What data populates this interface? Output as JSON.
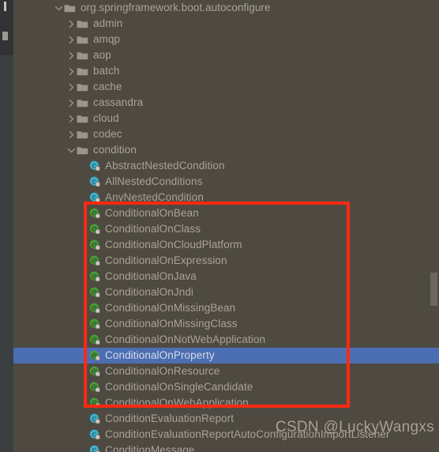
{
  "theme": {
    "background": "#4e4a41",
    "text": "#a9a398",
    "selection_background": "#4b6eb3",
    "selection_text": "#d6dbe3",
    "gutter": "#3c3f41",
    "annotation_box": "#fa2a12",
    "class_icon": "#3ab0c8",
    "annotation_icon": "#49a03b",
    "folder_icon": "#9b958b",
    "scrollbar_thumb": "#6c675d"
  },
  "tree": {
    "rows": [
      {
        "label": "org.springframework.boot.autoconfigure",
        "icon": "folder-icon",
        "expander": "chevron-down-icon",
        "depth": 0,
        "selected": false
      },
      {
        "label": "admin",
        "icon": "folder-icon",
        "expander": "chevron-right-icon",
        "depth": 1,
        "selected": false
      },
      {
        "label": "amqp",
        "icon": "folder-icon",
        "expander": "chevron-right-icon",
        "depth": 1,
        "selected": false
      },
      {
        "label": "aop",
        "icon": "folder-icon",
        "expander": "chevron-right-icon",
        "depth": 1,
        "selected": false
      },
      {
        "label": "batch",
        "icon": "folder-icon",
        "expander": "chevron-right-icon",
        "depth": 1,
        "selected": false
      },
      {
        "label": "cache",
        "icon": "folder-icon",
        "expander": "chevron-right-icon",
        "depth": 1,
        "selected": false
      },
      {
        "label": "cassandra",
        "icon": "folder-icon",
        "expander": "chevron-right-icon",
        "depth": 1,
        "selected": false
      },
      {
        "label": "cloud",
        "icon": "folder-icon",
        "expander": "chevron-right-icon",
        "depth": 1,
        "selected": false
      },
      {
        "label": "codec",
        "icon": "folder-icon",
        "expander": "chevron-right-icon",
        "depth": 1,
        "selected": false
      },
      {
        "label": "condition",
        "icon": "folder-icon",
        "expander": "chevron-down-icon",
        "depth": 1,
        "selected": false
      },
      {
        "label": "AbstractNestedCondition",
        "icon": "class-icon",
        "expander": "none",
        "depth": 2,
        "selected": false
      },
      {
        "label": "AllNestedConditions",
        "icon": "class-icon",
        "expander": "none",
        "depth": 2,
        "selected": false
      },
      {
        "label": "AnyNestedCondition",
        "icon": "class-icon",
        "expander": "none",
        "depth": 2,
        "selected": false
      },
      {
        "label": "ConditionalOnBean",
        "icon": "annotation-icon",
        "expander": "none",
        "depth": 2,
        "selected": false
      },
      {
        "label": "ConditionalOnClass",
        "icon": "annotation-icon",
        "expander": "none",
        "depth": 2,
        "selected": false
      },
      {
        "label": "ConditionalOnCloudPlatform",
        "icon": "annotation-icon",
        "expander": "none",
        "depth": 2,
        "selected": false
      },
      {
        "label": "ConditionalOnExpression",
        "icon": "annotation-icon",
        "expander": "none",
        "depth": 2,
        "selected": false
      },
      {
        "label": "ConditionalOnJava",
        "icon": "annotation-icon",
        "expander": "none",
        "depth": 2,
        "selected": false
      },
      {
        "label": "ConditionalOnJndi",
        "icon": "annotation-icon",
        "expander": "none",
        "depth": 2,
        "selected": false
      },
      {
        "label": "ConditionalOnMissingBean",
        "icon": "annotation-icon",
        "expander": "none",
        "depth": 2,
        "selected": false
      },
      {
        "label": "ConditionalOnMissingClass",
        "icon": "annotation-icon",
        "expander": "none",
        "depth": 2,
        "selected": false
      },
      {
        "label": "ConditionalOnNotWebApplication",
        "icon": "annotation-icon",
        "expander": "none",
        "depth": 2,
        "selected": false
      },
      {
        "label": "ConditionalOnProperty",
        "icon": "annotation-icon",
        "expander": "none",
        "depth": 2,
        "selected": true
      },
      {
        "label": "ConditionalOnResource",
        "icon": "annotation-icon",
        "expander": "none",
        "depth": 2,
        "selected": false
      },
      {
        "label": "ConditionalOnSingleCandidate",
        "icon": "annotation-icon",
        "expander": "none",
        "depth": 2,
        "selected": false
      },
      {
        "label": "ConditionalOnWebApplication",
        "icon": "annotation-icon",
        "expander": "none",
        "depth": 2,
        "selected": false
      },
      {
        "label": "ConditionEvaluationReport",
        "icon": "class-icon",
        "expander": "none",
        "depth": 2,
        "selected": false
      },
      {
        "label": "ConditionEvaluationReportAutoConfigurationImportListener",
        "icon": "class-icon",
        "expander": "none",
        "depth": 2,
        "selected": false
      },
      {
        "label": "ConditionMessage",
        "icon": "class-icon",
        "expander": "none",
        "depth": 2,
        "selected": false
      }
    ]
  },
  "annotation": {
    "highlight_box_label": "red-rectangle-highlight"
  },
  "watermark": {
    "text": "CSDN @LuckyWangxs"
  },
  "scrollbar": {
    "name": "vertical-scrollbar"
  }
}
